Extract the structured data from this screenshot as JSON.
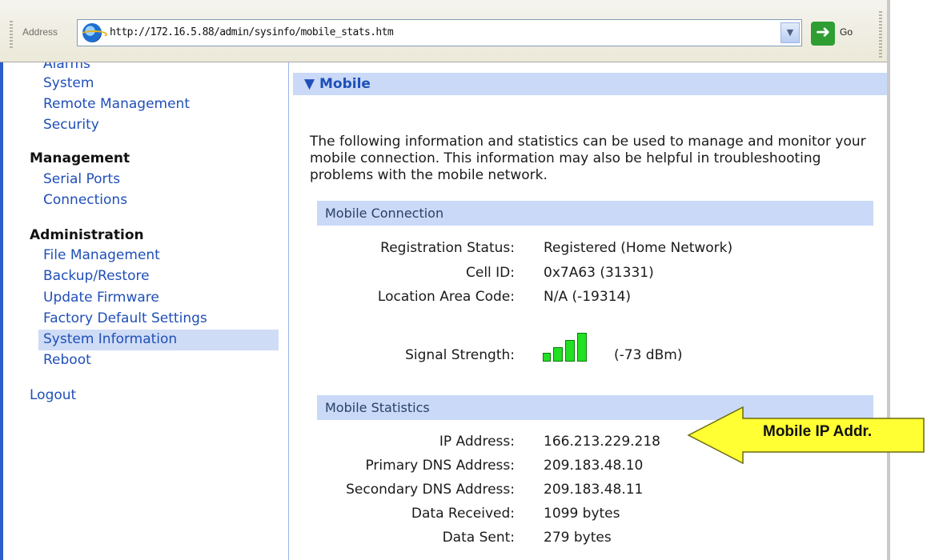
{
  "address_bar": {
    "label": "Address",
    "url": "http://172.16.5.88/admin/sysinfo/mobile_stats.htm",
    "go_label": "Go"
  },
  "sidebar": {
    "partial_item": "Alarms",
    "links_top": [
      "System",
      "Remote Management",
      "Security"
    ],
    "management_heading": "Management",
    "management_items": [
      "Serial Ports",
      "Connections"
    ],
    "administration_heading": "Administration",
    "administration_items": [
      "File Management",
      "Backup/Restore",
      "Update Firmware",
      "Factory Default Settings",
      "System Information",
      "Reboot"
    ],
    "selected_item": "System Information",
    "logout": "Logout"
  },
  "main": {
    "section_title": "Mobile",
    "intro": "The following information and statistics can be used to manage and monitor your mobile connection. This information may also be helpful in troubleshooting problems with the mobile network.",
    "connection": {
      "title": "Mobile Connection",
      "registration_label": "Registration Status:",
      "registration_value": "Registered (Home Network)",
      "cell_label": "Cell ID:",
      "cell_value": "0x7A63  (31331)",
      "lac_label": "Location Area Code:",
      "lac_value": "N/A  (-19314)",
      "signal_label": "Signal Strength:",
      "signal_value": "(-73 dBm)",
      "signal_bars_active": 4,
      "signal_bars_total": 4
    },
    "statistics": {
      "title": "Mobile Statistics",
      "rows": [
        {
          "label": "IP Address:",
          "value": "166.213.229.218"
        },
        {
          "label": "Primary DNS Address:",
          "value": "209.183.48.10"
        },
        {
          "label": "Secondary DNS Address:",
          "value": "209.183.48.11"
        },
        {
          "label": "Data Received:",
          "value": "1099 bytes"
        },
        {
          "label": "Data Sent:",
          "value": "279 bytes"
        }
      ]
    }
  },
  "annotation": {
    "text": "Mobile IP Addr.",
    "color": "#ffff33"
  }
}
